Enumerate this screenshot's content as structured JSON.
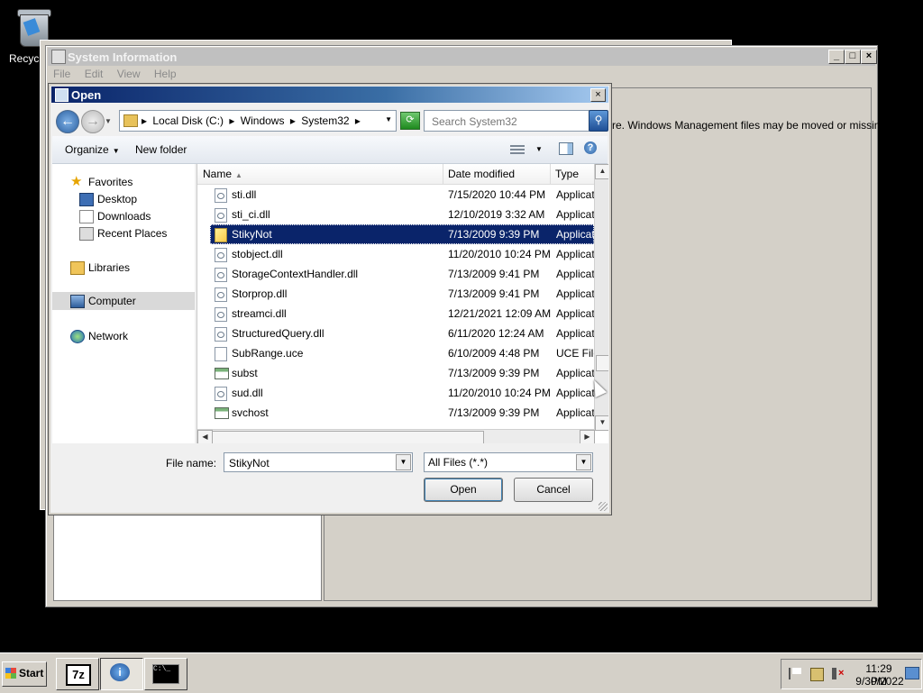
{
  "desktop": {
    "recycle_label": "Recycle"
  },
  "sysinfo": {
    "title": "System Information",
    "menu": [
      "File",
      "Edit",
      "View",
      "Help"
    ],
    "message": "re. Windows Management files may be moved or missing."
  },
  "dialog": {
    "title": "Open",
    "breadcrumbs": [
      "Local Disk (C:)",
      "Windows",
      "System32"
    ],
    "search_placeholder": "Search System32",
    "toolbar": {
      "organize": "Organize",
      "new_folder": "New folder"
    },
    "nav": {
      "favorites": "Favorites",
      "desktop": "Desktop",
      "downloads": "Downloads",
      "recent": "Recent Places",
      "libraries": "Libraries",
      "computer": "Computer",
      "network": "Network"
    },
    "columns": {
      "name": "Name",
      "date": "Date modified",
      "type": "Type"
    },
    "files": [
      {
        "name": "sti.dll",
        "date": "7/15/2020 10:44 PM",
        "type": "Application extension",
        "icon": "dll"
      },
      {
        "name": "sti_ci.dll",
        "date": "12/10/2019 3:32 AM",
        "type": "Application extension",
        "icon": "dll"
      },
      {
        "name": "StikyNot",
        "date": "7/13/2009 9:39 PM",
        "type": "Application",
        "icon": "app",
        "selected": true
      },
      {
        "name": "stobject.dll",
        "date": "11/20/2010 10:24 PM",
        "type": "Application extension",
        "icon": "dll"
      },
      {
        "name": "StorageContextHandler.dll",
        "date": "7/13/2009 9:41 PM",
        "type": "Application extension",
        "icon": "dll"
      },
      {
        "name": "Storprop.dll",
        "date": "7/13/2009 9:41 PM",
        "type": "Application extension",
        "icon": "dll"
      },
      {
        "name": "streamci.dll",
        "date": "12/21/2021 12:09 AM",
        "type": "Application extension",
        "icon": "dll"
      },
      {
        "name": "StructuredQuery.dll",
        "date": "6/11/2020 12:24 AM",
        "type": "Application extension",
        "icon": "dll"
      },
      {
        "name": "SubRange.uce",
        "date": "6/10/2009 4:48 PM",
        "type": "UCE File",
        "icon": "uce"
      },
      {
        "name": "subst",
        "date": "7/13/2009 9:39 PM",
        "type": "Application",
        "icon": "exe"
      },
      {
        "name": "sud.dll",
        "date": "11/20/2010 10:24 PM",
        "type": "Application extension",
        "icon": "dll"
      },
      {
        "name": "svchost",
        "date": "7/13/2009 9:39 PM",
        "type": "Application",
        "icon": "exe"
      }
    ],
    "file_name_label": "File name:",
    "file_name_value": "StikyNot",
    "filter": "All Files (*.*)",
    "open_label": "Open",
    "cancel_label": "Cancel"
  },
  "taskbar": {
    "start": "Start",
    "apps": [
      "7-Zip",
      "System Information",
      "Command Prompt"
    ],
    "clock_time": "11:29 PM",
    "clock_date": "9/30/2022"
  }
}
